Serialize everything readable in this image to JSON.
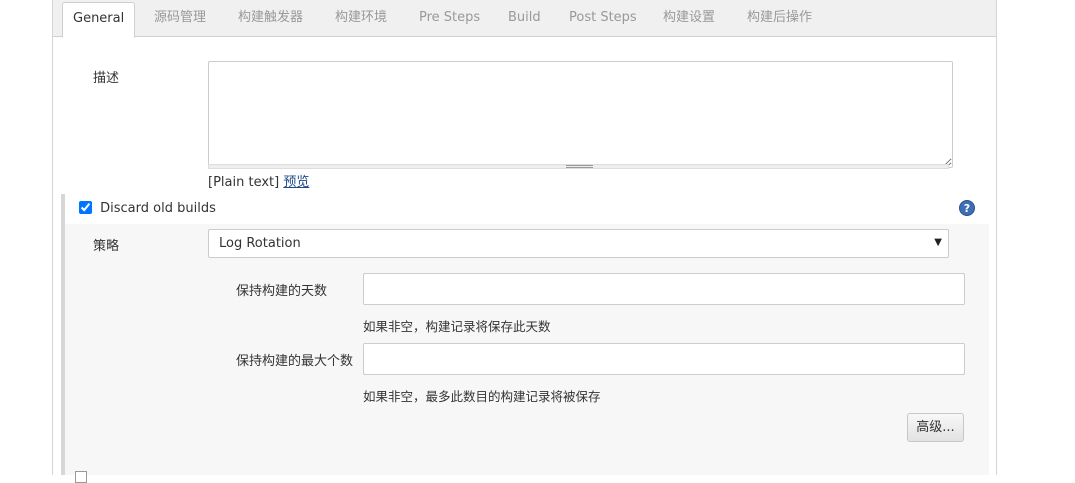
{
  "tabs": [
    {
      "label": "General",
      "active": true
    },
    {
      "label": "源码管理"
    },
    {
      "label": "构建触发器"
    },
    {
      "label": "构建环境"
    },
    {
      "label": "Pre Steps"
    },
    {
      "label": "Build"
    },
    {
      "label": "Post Steps"
    },
    {
      "label": "构建设置"
    },
    {
      "label": "构建后操作"
    }
  ],
  "description": {
    "label": "描述",
    "value": "",
    "format_hint": "[Plain text]",
    "preview_link": "预览"
  },
  "discard_builds": {
    "checkbox_label": "Discard old builds",
    "checked": true,
    "help_icon": "help-icon",
    "strategy_label": "策略",
    "strategy_value": "Log Rotation",
    "days_label": "保持构建的天数",
    "days_value": "",
    "days_hint": "如果非空，构建记录将保存此天数",
    "max_label": "保持构建的最大个数",
    "max_value": "",
    "max_hint": "如果非空，最多此数目的构建记录将被保存",
    "advanced_button": "高级..."
  },
  "colors": {
    "link": "#204a87",
    "help_icon": "#3d6fb5",
    "tab_bar": "#f0f0f0",
    "section_bg": "#f7f7f7"
  }
}
